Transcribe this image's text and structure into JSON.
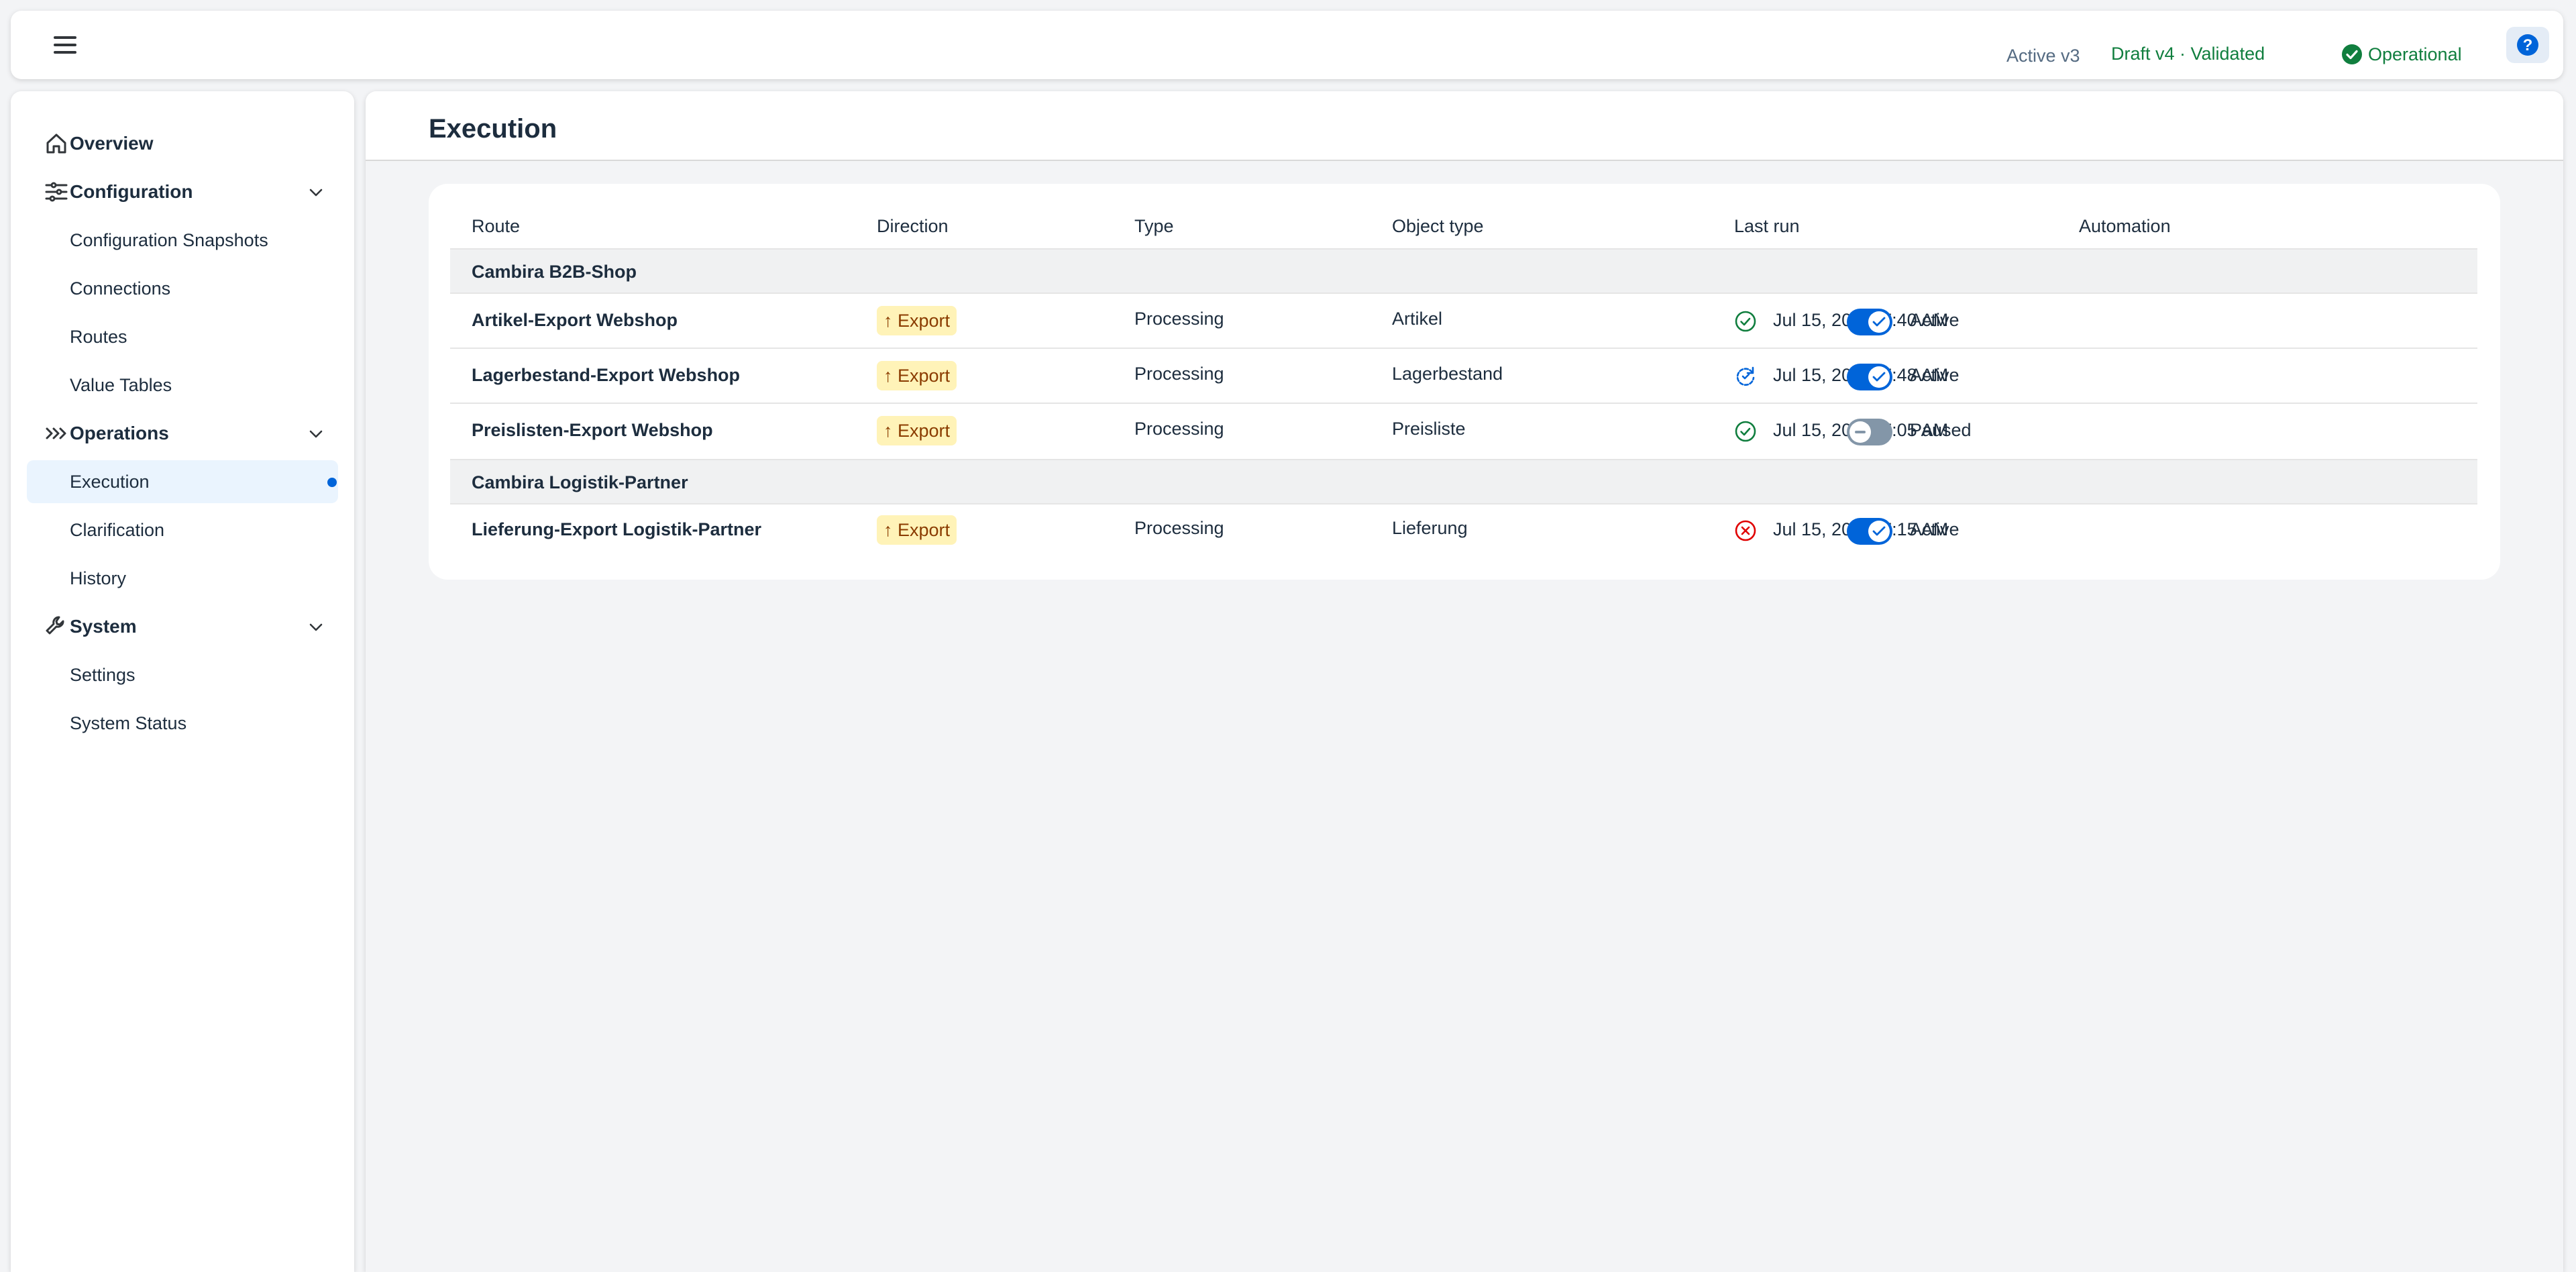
{
  "header": {
    "active_version": "Active v3",
    "draft_version": "Draft v4 · Validated",
    "status": "Operational"
  },
  "sidebar": {
    "items": [
      {
        "label": "Overview",
        "kind": "group",
        "icon": "home-icon"
      },
      {
        "label": "Configuration",
        "kind": "group",
        "icon": "sliders-icon",
        "expanded": true
      },
      {
        "label": "Configuration Snapshots",
        "kind": "sub"
      },
      {
        "label": "Connections",
        "kind": "sub"
      },
      {
        "label": "Routes",
        "kind": "sub"
      },
      {
        "label": "Value Tables",
        "kind": "sub"
      },
      {
        "label": "Operations",
        "kind": "group",
        "icon": "chevrons-right-icon",
        "expanded": true
      },
      {
        "label": "Execution",
        "kind": "sub",
        "selected": true
      },
      {
        "label": "Clarification",
        "kind": "sub"
      },
      {
        "label": "History",
        "kind": "sub"
      },
      {
        "label": "System",
        "kind": "group",
        "icon": "wrench-icon",
        "expanded": true
      },
      {
        "label": "Settings",
        "kind": "sub"
      },
      {
        "label": "System Status",
        "kind": "sub"
      }
    ]
  },
  "main": {
    "title": "Execution",
    "table": {
      "columns": [
        "Route",
        "Direction",
        "Type",
        "Object type",
        "Last run",
        "Automation"
      ],
      "groups": [
        {
          "name": "Cambira B2B-Shop",
          "rows": [
            {
              "route": "Artikel-Export Webshop",
              "direction": "↑ Export",
              "type": "Processing",
              "object_type": "Artikel",
              "last_run_status": "success",
              "last_run": "Jul 15, 2026, 7:40 AM",
              "automation_on": true,
              "automation": "Active"
            },
            {
              "route": "Lagerbestand-Export Webshop",
              "direction": "↑ Export",
              "type": "Processing",
              "object_type": "Lagerbestand",
              "last_run_status": "running",
              "last_run": "Jul 15, 2026, 7:48 AM",
              "automation_on": true,
              "automation": "Active"
            },
            {
              "route": "Preislisten-Export Webshop",
              "direction": "↑ Export",
              "type": "Processing",
              "object_type": "Preisliste",
              "last_run_status": "success",
              "last_run": "Jul 15, 2026, 7:05 AM",
              "automation_on": false,
              "automation": "Paused"
            }
          ]
        },
        {
          "name": "Cambira Logistik-Partner",
          "rows": [
            {
              "route": "Lieferung-Export Logistik-Partner",
              "direction": "↑ Export",
              "type": "Processing",
              "object_type": "Lieferung",
              "last_run_status": "error",
              "last_run": "Jul 15, 2026, 7:15 AM",
              "automation_on": true,
              "automation": "Active"
            }
          ]
        }
      ]
    }
  },
  "colors": {
    "accent": "#0064d9",
    "success": "#107e3e",
    "error": "#e00000",
    "badge_bg": "#fff3b8",
    "badge_text": "#8a3b00"
  }
}
